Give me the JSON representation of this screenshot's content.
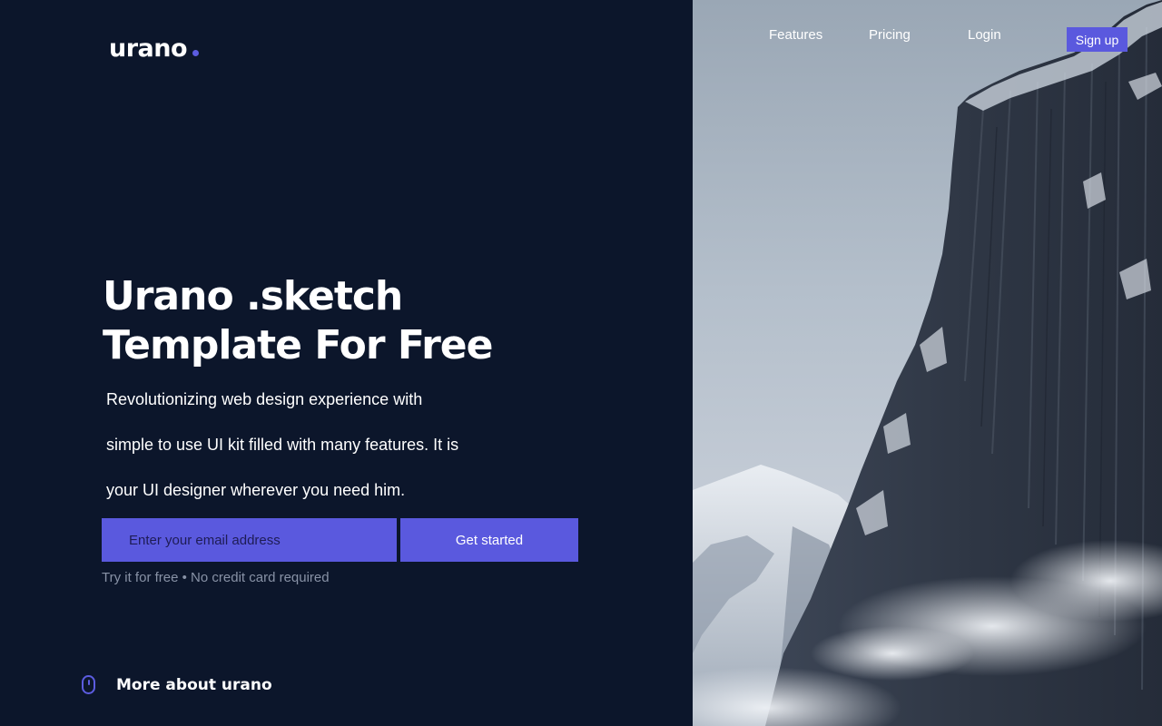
{
  "brand": {
    "name": "urano",
    "accent_color": "#5a59de",
    "background_color": "#0c162b"
  },
  "nav": {
    "features": "Features",
    "pricing": "Pricing",
    "login": "Login",
    "signup": "Sign up"
  },
  "hero": {
    "title_line1": "Urano .sketch",
    "title_line2": "Template For Free",
    "desc_line1": "Revolutionizing web design experience with",
    "desc_line2": "simple to use UI kit filled with many features. It is",
    "desc_line3": "your UI designer wherever you need him.",
    "email_placeholder": "Enter your email address",
    "cta_label": "Get started",
    "note": "Try it for free • No credit card required"
  },
  "footer_link": {
    "label": "More about urano",
    "icon": "mouse-scroll-icon"
  },
  "image": {
    "subject": "mountain-cliff-photo"
  }
}
